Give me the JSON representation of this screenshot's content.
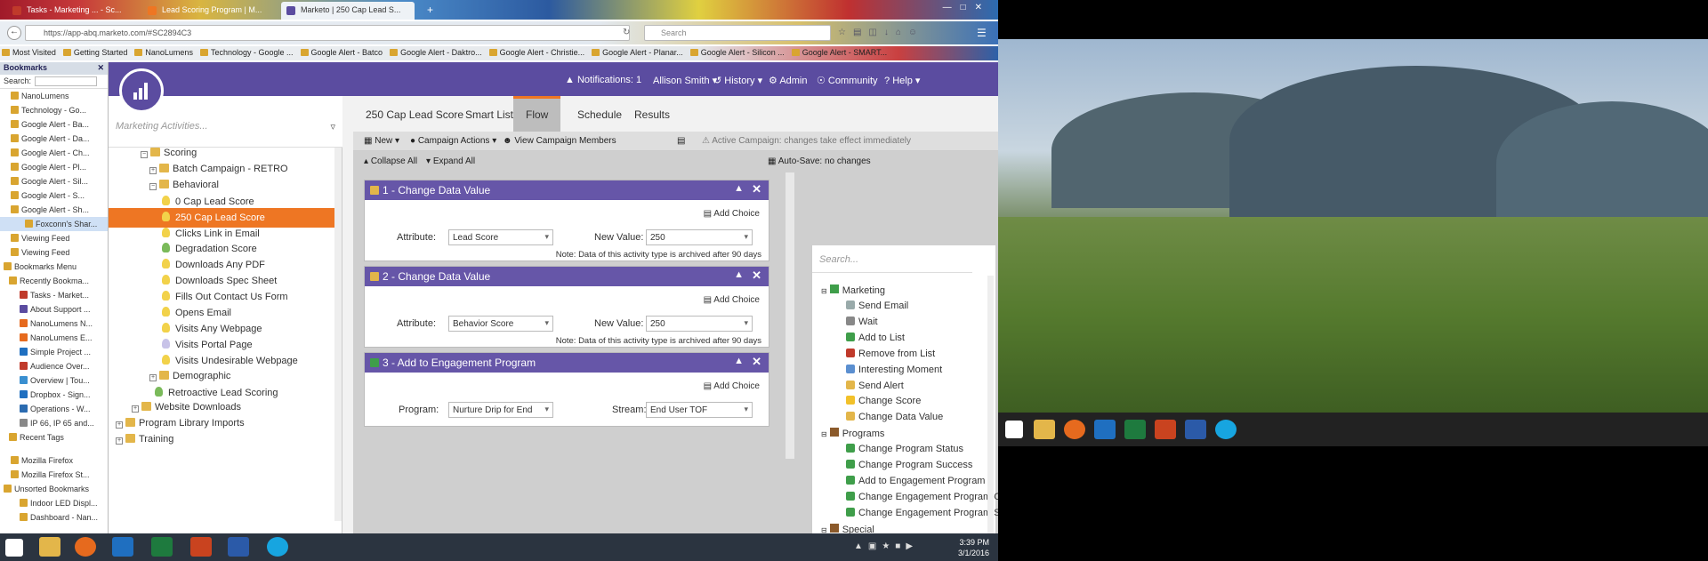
{
  "browser": {
    "tabs": [
      {
        "label": "Tasks - Marketing ... - Sc...",
        "color": "#c03a2b"
      },
      {
        "label": "Lead Scoring Program | M...",
        "color": "#ee7623"
      },
      {
        "label": "Marketo | 250 Cap Lead S...",
        "color": "#5b4ca0"
      }
    ],
    "new_tab": "+",
    "url": "https://app-abq.marketo.com/#SC2894C3",
    "search_placeholder": "Search",
    "bookmarks_bar": [
      "Most Visited",
      "Getting Started",
      "NanoLumens",
      "Technology - Google ...",
      "Google Alert - Batco",
      "Google Alert - Daktro...",
      "Google Alert - Christie...",
      "Google Alert - Planar...",
      "Google Alert - Silicon ...",
      "Google Alert - SMART..."
    ]
  },
  "sidebar": {
    "title": "Bookmarks",
    "search_label": "Search:",
    "items": [
      "NanoLumens",
      "Technology - Go...",
      "Google Alert - Ba...",
      "Google Alert - Da...",
      "Google Alert - Ch...",
      "Google Alert - Pl...",
      "Google Alert - Sil...",
      "Google Alert - S...",
      "Google Alert - Sh...",
      "Foxconn's Shar...",
      "Viewing Feed",
      "Viewing Feed",
      "Bookmarks Menu",
      "Recently Bookma...",
      "Tasks - Market...",
      "About Support ...",
      "NanoLumens N...",
      "NanoLumens E...",
      "Simple Project ...",
      "Audience Over...",
      "Overview | Tou...",
      "Dropbox - Sign...",
      "Operations - W...",
      "IP 66, IP 65 and...",
      "Recent Tags",
      "Mozilla Firefox",
      "Mozilla Firefox St...",
      "Unsorted Bookmarks",
      "Indoor LED Displ...",
      "Dashboard - Nan..."
    ]
  },
  "topnav": {
    "notifications": "Notifications: 1",
    "user": "Allison Smith",
    "history": "History",
    "admin": "Admin",
    "community": "Community",
    "help": "Help"
  },
  "tree": {
    "search_placeholder": "Marketing Activities...",
    "items": [
      {
        "label": "Scoring",
        "type": "folder"
      },
      {
        "label": "Batch Campaign - RETRO",
        "type": "folder"
      },
      {
        "label": "Behavioral",
        "type": "folder"
      },
      {
        "label": "0 Cap Lead Score",
        "type": "bulb"
      },
      {
        "label": "250 Cap Lead Score",
        "type": "bulb"
      },
      {
        "label": "Clicks Link in Email",
        "type": "bulb"
      },
      {
        "label": "Degradation Score",
        "type": "green"
      },
      {
        "label": "Downloads Any PDF",
        "type": "bulb"
      },
      {
        "label": "Downloads Spec Sheet",
        "type": "bulb"
      },
      {
        "label": "Fills Out Contact Us Form",
        "type": "bulb"
      },
      {
        "label": "Opens Email",
        "type": "bulb"
      },
      {
        "label": "Visits Any Webpage",
        "type": "bulb"
      },
      {
        "label": "Visits Portal Page",
        "type": "purple"
      },
      {
        "label": "Visits Undesirable Webpage",
        "type": "bulb"
      },
      {
        "label": "Demographic",
        "type": "folder"
      },
      {
        "label": "Retroactive Lead Scoring",
        "type": "green"
      },
      {
        "label": "Website Downloads",
        "type": "folder"
      },
      {
        "label": "Program Library Imports",
        "type": "folder"
      },
      {
        "label": "Training",
        "type": "folder"
      }
    ]
  },
  "tabs": [
    "250 Cap Lead Score",
    "Smart List",
    "Flow",
    "Schedule",
    "Results"
  ],
  "toolbar": {
    "new": "New",
    "campaign_actions": "Campaign Actions",
    "view_members": "View Campaign Members",
    "active_note": "Active Campaign: changes take effect immediately",
    "collapse_all": "Collapse All",
    "expand_all": "Expand All",
    "autosave": "Auto-Save: no changes"
  },
  "flow_steps": [
    {
      "title": "1 - Change Data Value",
      "add_choice": "Add Choice",
      "label1": "Attribute:",
      "value1": "Lead Score",
      "label2": "New Value:",
      "value2": "250",
      "note": "Note: Data of this activity type is archived after 90 days"
    },
    {
      "title": "2 - Change Data Value",
      "add_choice": "Add Choice",
      "label1": "Attribute:",
      "value1": "Behavior Score",
      "label2": "New Value:",
      "value2": "250",
      "note": "Note: Data of this activity type is archived after 90 days"
    },
    {
      "title": "3 - Add to Engagement Program",
      "add_choice": "Add Choice",
      "label1": "Program:",
      "value1": "Nurture Drip for End",
      "label2": "Stream:",
      "value2": "End User TOF",
      "note": ""
    }
  ],
  "palette": {
    "search_placeholder": "Search...",
    "groups": [
      {
        "label": "Marketing",
        "items": [
          "Send Email",
          "Wait",
          "Add to List",
          "Remove from List",
          "Interesting Moment",
          "Send Alert",
          "Change Score",
          "Change Data Value"
        ]
      },
      {
        "label": "Programs",
        "items": [
          "Change Program Status",
          "Change Program Success",
          "Add to Engagement Program",
          "Change Engagement Program Cad",
          "Change Engagement Program Str"
        ]
      },
      {
        "label": "Special",
        "items": []
      }
    ]
  },
  "taskbar": {
    "time": "3:39 PM",
    "date": "3/1/2016"
  },
  "colors": {
    "accent": "#ee7623",
    "brand": "#5b4ca0"
  }
}
